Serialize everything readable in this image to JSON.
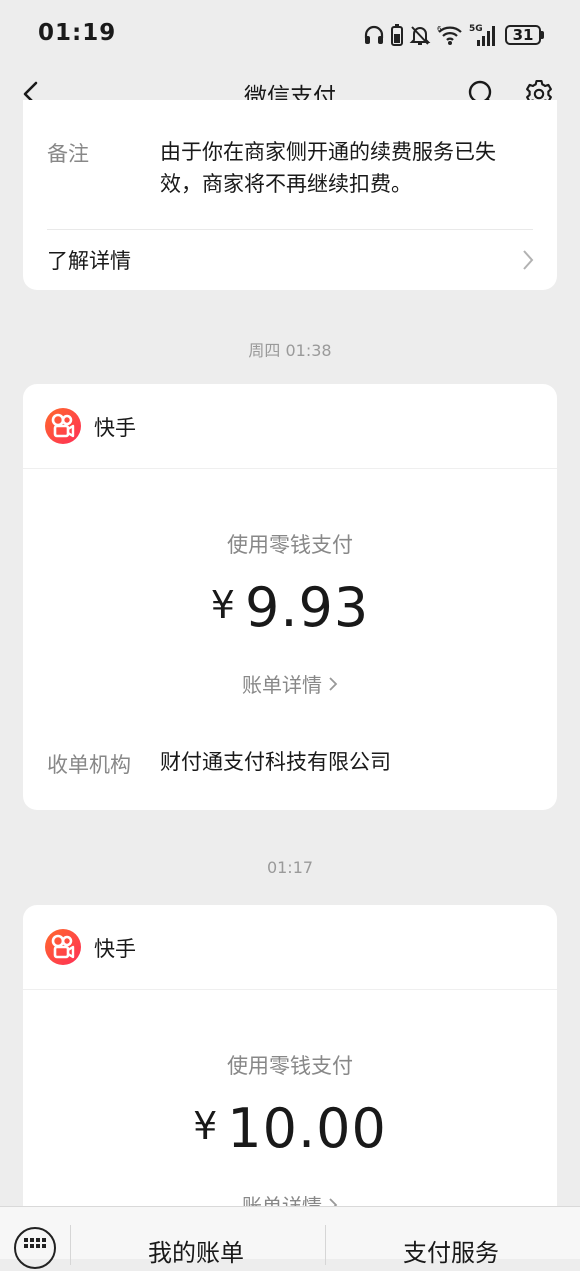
{
  "status_bar": {
    "time": "01:19",
    "battery": "31",
    "icons": [
      "headphones-icon",
      "battery-saver-icon",
      "mute-icon",
      "wifi-icon",
      "signal-5g-icon",
      "battery-icon"
    ],
    "network_label": "5G"
  },
  "nav": {
    "title": "微信支付",
    "back_icon": "chevron-left-icon",
    "search_icon": "search-icon",
    "settings_icon": "gear-icon"
  },
  "top_card": {
    "note_label": "备注",
    "note_value": "由于你在商家侧开通的续费服务已失效，商家将不再继续扣费。",
    "detail_link": "了解详情"
  },
  "messages": [
    {
      "timestamp": "周四 01:38",
      "merchant": "快手",
      "pay_method": "使用零钱支付",
      "currency": "¥",
      "amount": "9.93",
      "bill_link": "账单详情",
      "org_label": "收单机构",
      "org_value": "财付通支付科技有限公司"
    },
    {
      "timestamp": "01:17",
      "merchant": "快手",
      "pay_method": "使用零钱支付",
      "currency": "¥",
      "amount": "10.00",
      "bill_link": "账单详情"
    }
  ],
  "bottom_bar": {
    "keyboard_icon": "keyboard-icon",
    "menu1": "我的账单",
    "menu2": "支付服务"
  },
  "colors": {
    "background": "#ededed",
    "card": "#ffffff",
    "merchant_logo": "#ff4a3d"
  }
}
